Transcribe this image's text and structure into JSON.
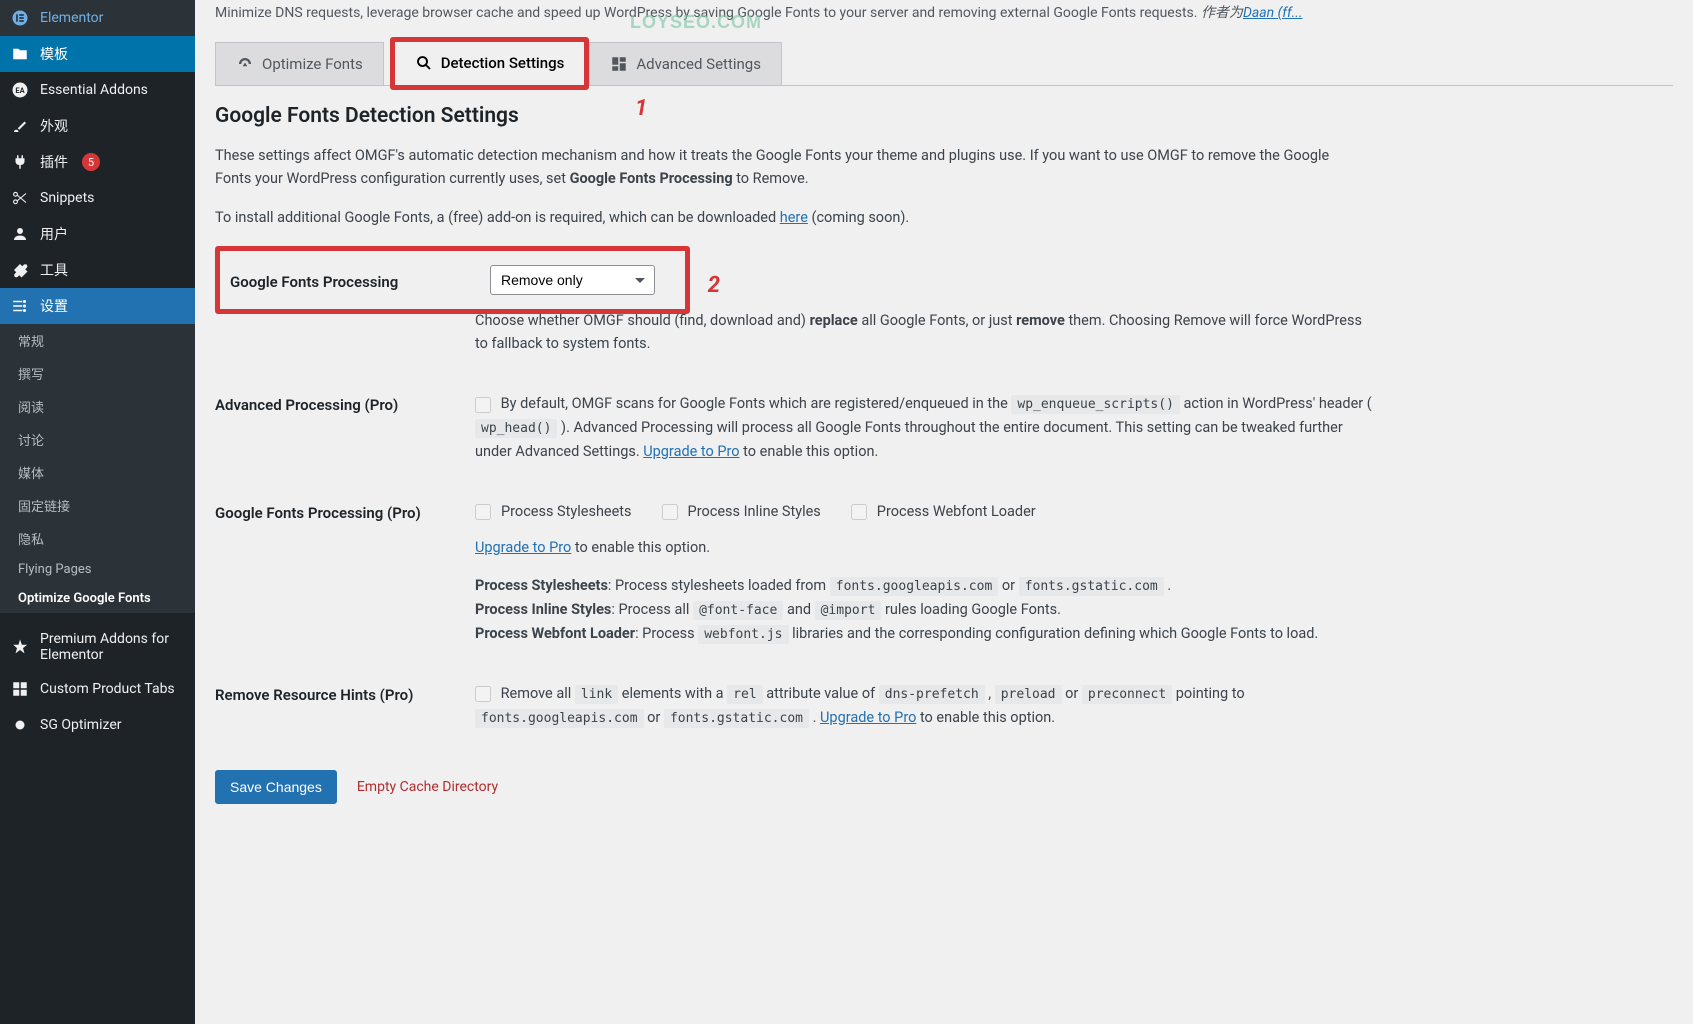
{
  "watermark": "LOYSEO.COM",
  "sidebar": {
    "items": [
      {
        "label": "Elementor",
        "icon": "elementor"
      },
      {
        "label": "模板",
        "icon": "folder",
        "highlighted": true
      },
      {
        "label": "Essential Addons",
        "icon": "ea"
      },
      {
        "label": "外观",
        "icon": "brush"
      },
      {
        "label": "插件",
        "icon": "plug",
        "badge": "5"
      },
      {
        "label": "Snippets",
        "icon": "scissors"
      },
      {
        "label": "用户",
        "icon": "user"
      },
      {
        "label": "工具",
        "icon": "wrench"
      },
      {
        "label": "设置",
        "icon": "settings",
        "active": true
      }
    ],
    "submenu": [
      {
        "label": "常规"
      },
      {
        "label": "撰写"
      },
      {
        "label": "阅读"
      },
      {
        "label": "讨论"
      },
      {
        "label": "媒体"
      },
      {
        "label": "固定链接"
      },
      {
        "label": "隐私"
      },
      {
        "label": "Flying Pages"
      },
      {
        "label": "Optimize Google Fonts",
        "current": true
      }
    ],
    "bottom": [
      {
        "label": "Premium Addons for Elementor",
        "icon": "star"
      },
      {
        "label": "Custom Product Tabs",
        "icon": "grid"
      },
      {
        "label": "SG Optimizer",
        "icon": "dot"
      }
    ]
  },
  "intro": {
    "text_prefix": "Minimize DNS requests, leverage browser cache and speed up WordPress by saving Google Fonts to your server and removing external Google Fonts requests. ",
    "author_prefix": "作者为",
    "author_link": "Daan (ff..."
  },
  "tabs": {
    "optimize": "Optimize Fonts",
    "detection": "Detection Settings",
    "advanced": "Advanced Settings"
  },
  "annotations": {
    "a1": "1",
    "a2": "2"
  },
  "section": {
    "title": "Google Fonts Detection Settings",
    "desc1_a": "These settings affect OMGF's automatic detection mechanism and how it treats the Google Fonts your theme and plugins use. If you want to use OMGF to remove the Google Fonts your WordPress configuration currently uses, set ",
    "desc1_b": "Google Fonts Processing",
    "desc1_c": " to Remove.",
    "desc2_a": "To install additional Google Fonts, a (free) add-on is required, which can be downloaded ",
    "desc2_link": "here",
    "desc2_b": " (coming soon)."
  },
  "rows": {
    "processing": {
      "label": "Google Fonts Processing",
      "select_value": "Remove only",
      "help_a": "Choose whether OMGF should (find, download and) ",
      "help_b": "replace",
      "help_c": " all Google Fonts, or just ",
      "help_d": "remove",
      "help_e": " them. Choosing Remove will force WordPress to fallback to system fonts."
    },
    "advanced_proc": {
      "label": "Advanced Processing (Pro)",
      "help_a": "By default, OMGF scans for Google Fonts which are registered/enqueued in the ",
      "code1": "wp_enqueue_scripts()",
      "help_b": " action in WordPress' header ( ",
      "code2": "wp_head()",
      "help_c": " ). Advanced Processing will process all Google Fonts throughout the entire document. This setting can be tweaked further under Advanced Settings. ",
      "link": "Upgrade to Pro",
      "help_d": " to enable this option."
    },
    "processing_pro": {
      "label": "Google Fonts Processing (Pro)",
      "chk1": "Process Stylesheets",
      "chk2": "Process Inline Styles",
      "chk3": "Process Webfont Loader",
      "link": "Upgrade to Pro",
      "help_a": " to enable this option.",
      "ps_label": "Process Stylesheets",
      "ps_text_a": ": Process stylesheets loaded from ",
      "ps_code1": "fonts.googleapis.com",
      "ps_or": " or ",
      "ps_code2": "fonts.gstatic.com",
      "ps_dot": " .",
      "pi_label": "Process Inline Styles",
      "pi_text_a": ": Process all ",
      "pi_code1": "@font-face",
      "pi_and": " and ",
      "pi_code2": "@import",
      "pi_text_b": " rules loading Google Fonts.",
      "pw_label": "Process Webfont Loader",
      "pw_text_a": ": Process ",
      "pw_code1": "webfont.js",
      "pw_text_b": " libraries and the corresponding configuration defining which Google Fonts to load."
    },
    "resource_hints": {
      "label": "Remove Resource Hints (Pro)",
      "help_a": "Remove all ",
      "code1": "link",
      "help_b": " elements with a ",
      "code2": "rel",
      "help_c": " attribute value of ",
      "code3": "dns-prefetch",
      "comma": " , ",
      "code4": "preload",
      "or": " or ",
      "code5": "preconnect",
      "help_d": " pointing to ",
      "code6": "fonts.googleapis.com",
      "or2": " or ",
      "code7": "fonts.gstatic.com",
      "dot": " . ",
      "link": "Upgrade to Pro",
      "help_e": " to enable this option."
    }
  },
  "buttons": {
    "save": "Save Changes",
    "empty": "Empty Cache Directory"
  }
}
